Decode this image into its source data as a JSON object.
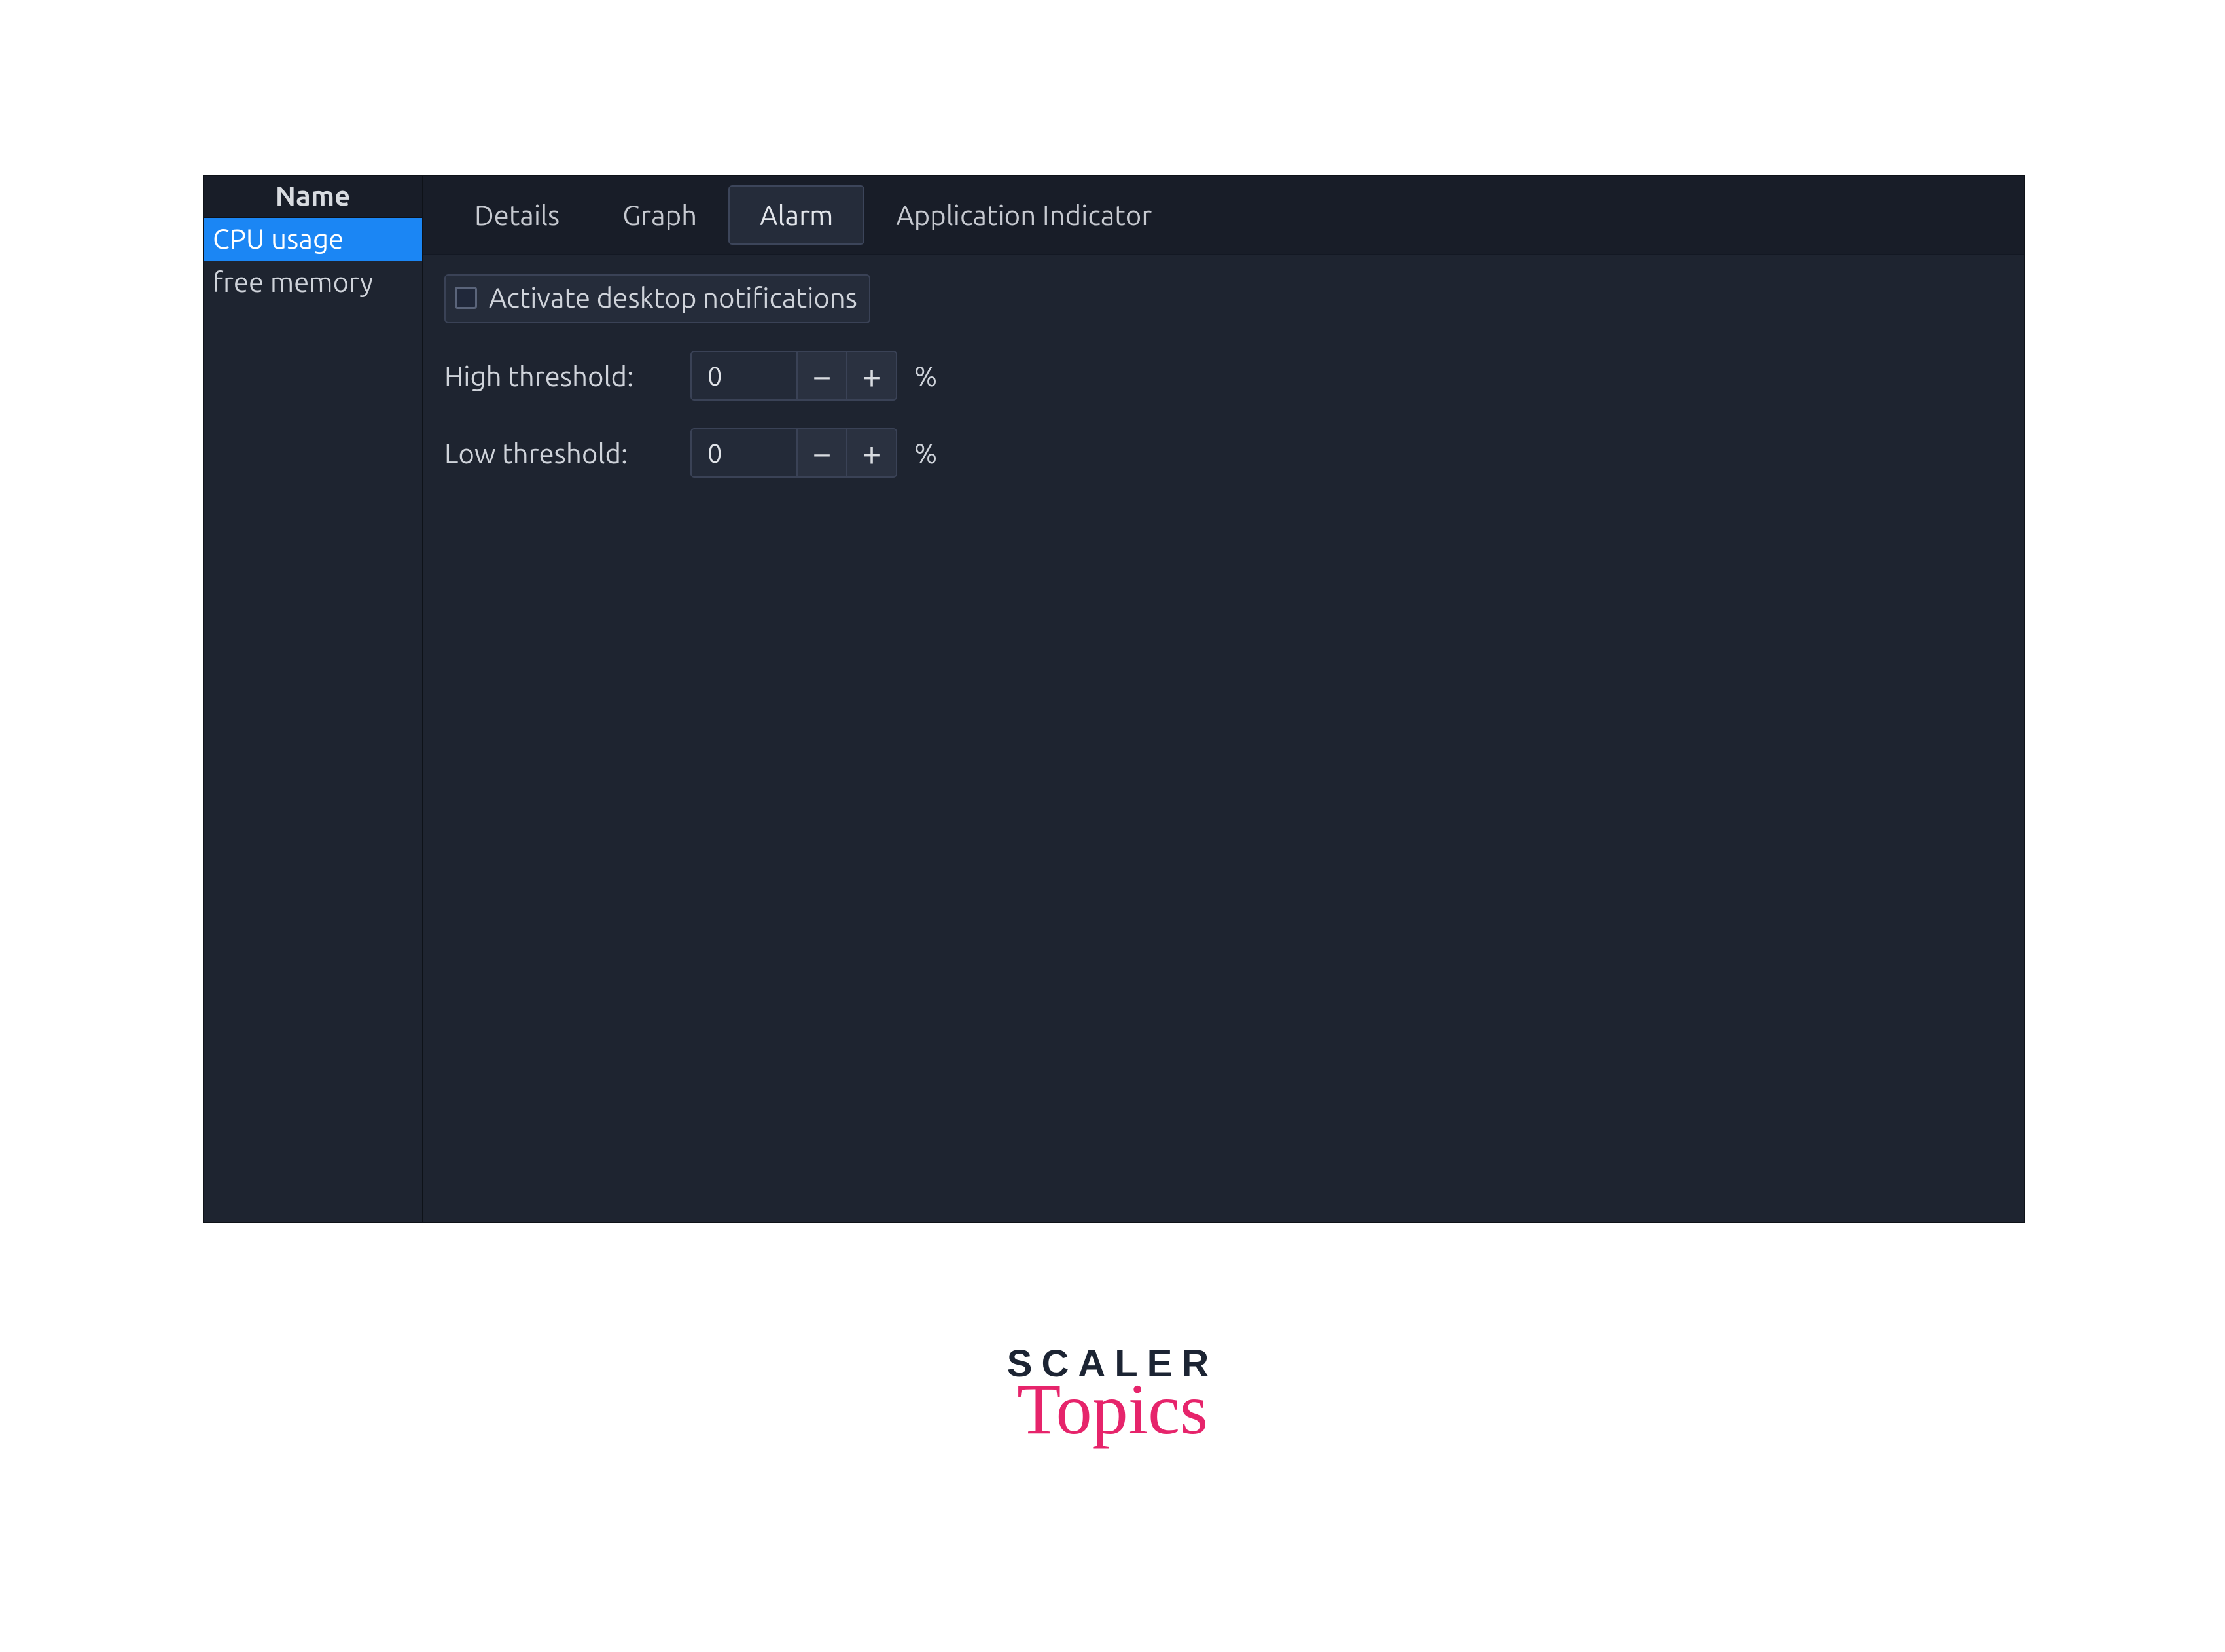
{
  "sidebar": {
    "header": "Name",
    "items": [
      {
        "label": "CPU usage",
        "selected": true
      },
      {
        "label": "free memory",
        "selected": false
      }
    ]
  },
  "tabs": [
    {
      "label": "Details",
      "active": false
    },
    {
      "label": "Graph",
      "active": false
    },
    {
      "label": "Alarm",
      "active": true
    },
    {
      "label": "Application Indicator",
      "active": false
    }
  ],
  "alarm": {
    "checkbox_label": "Activate desktop notifications",
    "checkbox_checked": false,
    "high_label": "High threshold:",
    "high_value": "0",
    "low_label": "Low threshold:",
    "low_value": "0",
    "unit": "%",
    "minus": "−",
    "plus": "+"
  },
  "branding": {
    "line1": "SCALER",
    "line2": "Topics"
  }
}
